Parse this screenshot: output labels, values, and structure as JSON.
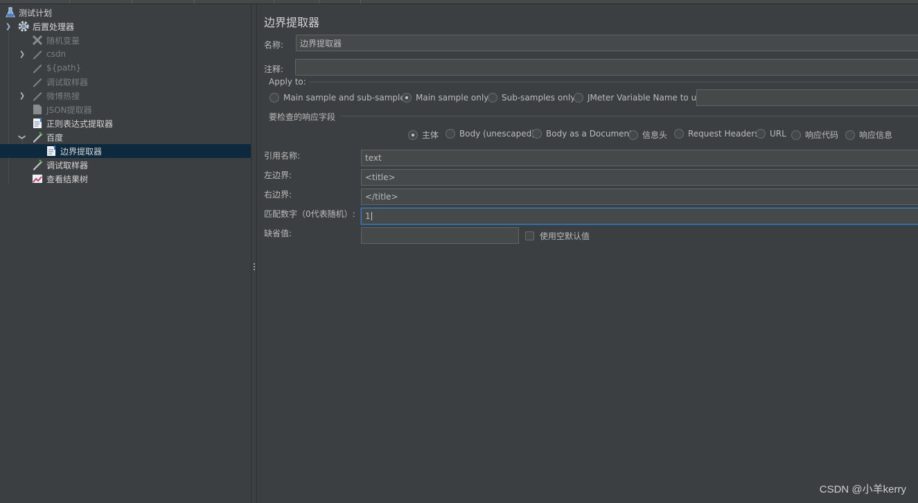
{
  "tree": {
    "items": [
      {
        "label": "测试计划",
        "icon": "flask-icon",
        "style": "norm"
      },
      {
        "label": "后置处理器",
        "icon": "gear-icon",
        "style": "norm",
        "expanded": true
      },
      {
        "label": "随机变量",
        "icon": "tools-icon",
        "style": "dim"
      },
      {
        "label": "csdn",
        "icon": "pencil-icon",
        "style": "dim"
      },
      {
        "label": "${path}",
        "icon": "pencil-icon",
        "style": "dim"
      },
      {
        "label": "调试取样器",
        "icon": "pencil-icon",
        "style": "dim"
      },
      {
        "label": "微博热搜",
        "icon": "pencil-icon",
        "style": "dim"
      },
      {
        "label": "JSON提取器",
        "icon": "document-icon",
        "style": "dim"
      },
      {
        "label": "正则表达式提取器",
        "icon": "document-icon",
        "style": "norm"
      },
      {
        "label": "百度",
        "icon": "pencil-icon",
        "style": "norm",
        "expanded": true
      },
      {
        "label": "边界提取器",
        "icon": "document-icon",
        "style": "norm",
        "selected": true
      },
      {
        "label": "调试取样器",
        "icon": "pencil-icon",
        "style": "norm"
      },
      {
        "label": "查看结果树",
        "icon": "chart-icon",
        "style": "norm"
      }
    ]
  },
  "panel": {
    "title": "边界提取器",
    "name_label": "名称:",
    "name_value": "边界提取器",
    "comment_label": "注释:",
    "comment_value": "",
    "apply_to": {
      "title": "Apply to:",
      "options": [
        "Main sample and sub-samples",
        "Main sample only",
        "Sub-samples only",
        "JMeter Variable Name to use"
      ],
      "selected": "Main sample only",
      "variable_value": ""
    },
    "field_group": {
      "title": "要检查的响应字段",
      "options": [
        "主体",
        "Body (unescaped)",
        "Body as a Document",
        "信息头",
        "Request Headers",
        "URL",
        "响应代码",
        "响应信息"
      ],
      "selected": "主体"
    },
    "ref_name_label": "引用名称:",
    "ref_name_value": "text",
    "left_boundary_label": "左边界:",
    "left_boundary_value": "<title>",
    "right_boundary_label": "右边界:",
    "right_boundary_value": "</title>",
    "match_no_label": "匹配数字（0代表随机）:",
    "match_no_value": "1",
    "default_label": "缺省值:",
    "default_value": "",
    "empty_default_label": "使用空默认值"
  },
  "watermark": "CSDN @小羊kerry",
  "colors": {
    "background": "#3c3f41",
    "selected_row": "#0d293e",
    "focus_border": "#3d78b5"
  }
}
